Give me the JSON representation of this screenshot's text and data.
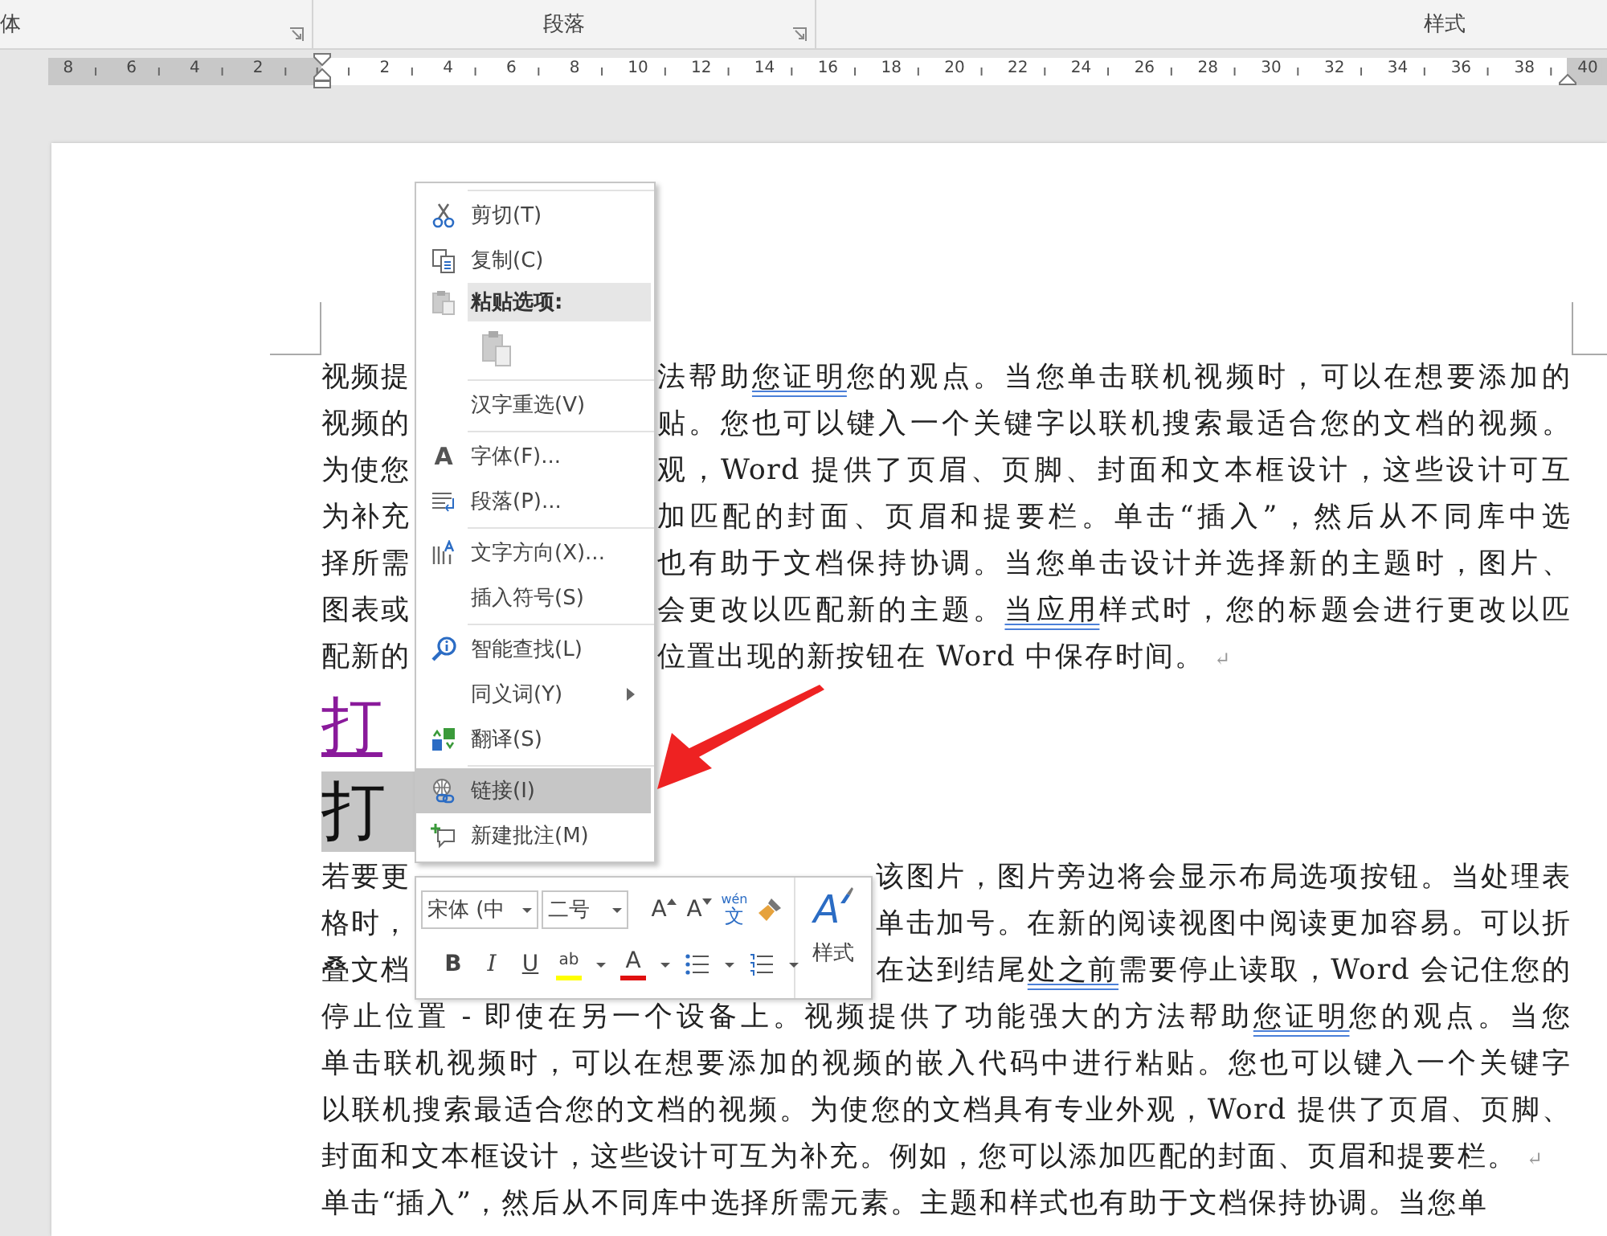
{
  "ribbon": {
    "groups": [
      {
        "label": "体",
        "launcher": true
      },
      {
        "label": "段落",
        "launcher": true
      },
      {
        "label": "样式",
        "launcher": false
      }
    ]
  },
  "ruler": {
    "left_labels": [
      "8",
      "6",
      "4",
      "2"
    ],
    "right_labels": [
      "2",
      "4",
      "6",
      "8",
      "10",
      "12",
      "14",
      "16",
      "18",
      "20",
      "22",
      "24",
      "26",
      "28",
      "30",
      "32",
      "34",
      "36",
      "38",
      "40"
    ]
  },
  "document": {
    "blocks": [
      {
        "kind": "paragraph",
        "lines": [
          {
            "left": "视频提",
            "right": [
              {
                "text": "法帮助",
                "flagged": false
              },
              {
                "text": "您证明",
                "flagged": true
              },
              {
                "text": "您的观点。当您单击联机视频时，可以在想要添加的",
                "flagged": false
              }
            ]
          },
          {
            "left": "视频的",
            "right": [
              {
                "text": "贴。您也可以键入一个关键字以联机搜索最适合您的文档的视频。",
                "flagged": false
              }
            ]
          },
          {
            "left": "为使您",
            "right": [
              {
                "text": "观，Word 提供了页眉、页脚、封面和文本框设计，这些设计可互",
                "flagged": false
              }
            ]
          },
          {
            "left": "为补充",
            "right": [
              {
                "text": "加匹配的封面、页眉和提要栏。单击“插入”，然后从不同库中选",
                "flagged": false
              }
            ]
          },
          {
            "left": "择所需",
            "right": [
              {
                "text": "也有助于文档保持协调。当您单击设计并选择新的主题时，图片、",
                "flagged": false
              }
            ]
          },
          {
            "left": "图表或",
            "right": [
              {
                "text": "会更改以匹配新的主题。",
                "flagged": false
              },
              {
                "text": "当应用",
                "flagged": true
              },
              {
                "text": "样式时，您的标题会进行更改以匹",
                "flagged": false
              }
            ]
          },
          {
            "left": "配新的",
            "right": [
              {
                "text": "位置出现的新按钮在 Word 中保存时间。",
                "flagged": false
              }
            ],
            "mark": "↵"
          }
        ]
      },
      {
        "kind": "link-heading",
        "text": "打"
      },
      {
        "kind": "highlight-heading",
        "text": "打"
      },
      {
        "kind": "paragraph",
        "lines": [
          {
            "left": "若要更",
            "right": [
              {
                "text": "该图片，图片旁边将会显示布局选项按钮。当处理表",
                "flagged": false
              }
            ]
          },
          {
            "left": "格时，",
            "right": [
              {
                "text": "单击加号。在新的阅读视图中阅读更加容易。可以折",
                "flagged": false
              }
            ]
          },
          {
            "left": "叠文档",
            "right": [
              {
                "text": "在达到结尾",
                "flagged": false
              },
              {
                "text": "处之前",
                "flagged": true
              },
              {
                "text": "需要停止读取，Word 会记住您的",
                "flagged": false
              }
            ]
          },
          {
            "right": [
              {
                "text": "停止位置 - 即使在另一个设备上。视频提供了功能强大的方法帮助",
                "flagged": false
              },
              {
                "text": "您证明",
                "flagged": true
              },
              {
                "text": "您的观点。当您",
                "flagged": false
              }
            ]
          },
          {
            "right": [
              {
                "text": "单击联机视频时，可以在想要添加的视频的嵌入代码中进行粘贴。您也可以键入一个关键字",
                "flagged": false
              }
            ]
          },
          {
            "right": [
              {
                "text": "以联机搜索最适合您的文档的视频。为使您的文档具有专业外观，Word 提供了页眉、页脚、",
                "flagged": false
              }
            ]
          },
          {
            "right": [
              {
                "text": "封面和文本框设计，这些设计可互为补充。例如，您可以添加匹配的封面、页眉和提要栏。",
                "flagged": false
              }
            ],
            "mark": "↵"
          }
        ]
      },
      {
        "kind": "paragraph",
        "lines": [
          {
            "right": [
              {
                "text": "单击“插入”，然后从不同库中选择所需元素。主题和样式也有助于文档保持协调。当您单",
                "flagged": false
              }
            ]
          }
        ]
      }
    ]
  },
  "context_menu": {
    "sections": [
      [
        {
          "kind": "cut",
          "label": "剪切(T)",
          "selected": false
        },
        {
          "kind": "copy",
          "label": "复制(C)",
          "selected": false
        },
        {
          "kind": "paste-header",
          "label": "粘贴选项:",
          "selected": false
        },
        {
          "kind": "paste-button",
          "selected": false
        }
      ],
      [
        {
          "kind": "plain",
          "label": "汉字重选(V)",
          "selected": false
        }
      ],
      [
        {
          "kind": "font",
          "label": "字体(F)...",
          "glyph": "A",
          "selected": false
        },
        {
          "kind": "paragraph",
          "label": "段落(P)...",
          "selected": false
        }
      ],
      [
        {
          "kind": "text-direction",
          "label": "文字方向(X)...",
          "selected": false
        },
        {
          "kind": "plain",
          "label": "插入符号(S)",
          "selected": false
        }
      ],
      [
        {
          "kind": "smart-lookup",
          "label": "智能查找(L)",
          "selected": false
        },
        {
          "kind": "submenu",
          "label": "同义词(Y)",
          "selected": false
        },
        {
          "kind": "translate",
          "label": "翻译(S)",
          "selected": false
        }
      ],
      [
        {
          "kind": "link",
          "label": "链接(I)",
          "selected": true
        },
        {
          "kind": "comment",
          "label": "新建批注(M)",
          "selected": false
        }
      ]
    ]
  },
  "mini_toolbar": {
    "font": "宋体 (中",
    "size": "二号",
    "row1": [
      {
        "kind": "grow",
        "label": "A"
      },
      {
        "kind": "shrink",
        "label": "A"
      },
      {
        "kind": "phonetic",
        "label": "文",
        "ruby": "wén"
      },
      {
        "kind": "painter"
      }
    ],
    "row2": [
      {
        "kind": "bold",
        "label": "B"
      },
      {
        "kind": "italic",
        "label": "I"
      },
      {
        "kind": "underline",
        "label": "U"
      },
      {
        "kind": "highlight",
        "label": "ab"
      },
      {
        "kind": "font-color",
        "label": "A"
      },
      {
        "kind": "bullets"
      },
      {
        "kind": "numbering"
      }
    ],
    "styles": {
      "glyph": "A",
      "label": "样式"
    }
  }
}
